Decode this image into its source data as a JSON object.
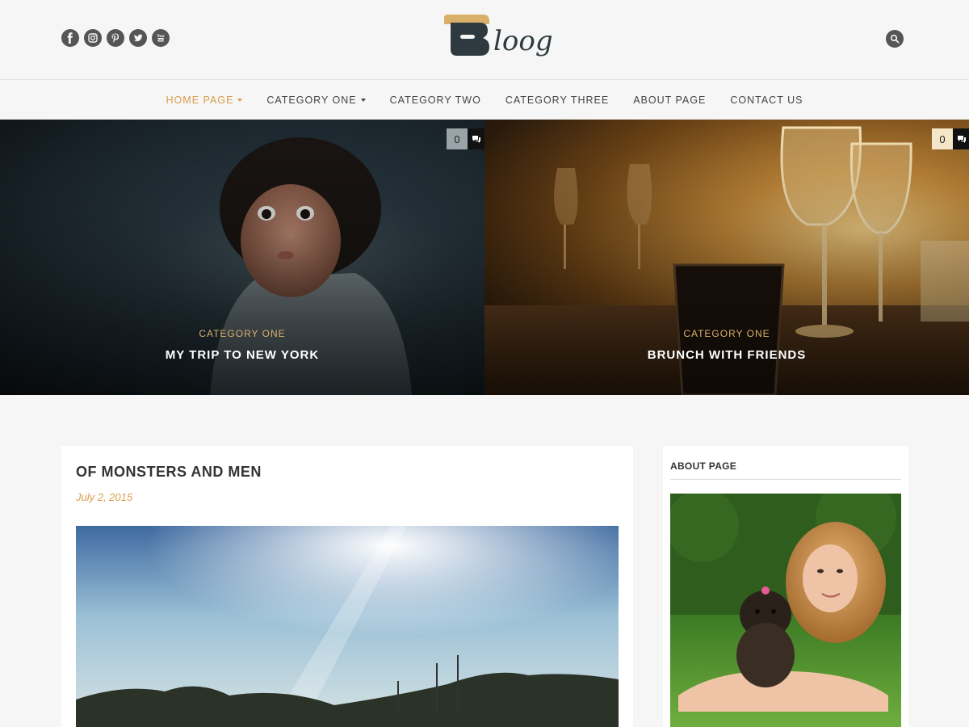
{
  "header": {
    "social": [
      {
        "icon": "facebook-icon"
      },
      {
        "icon": "instagram-icon"
      },
      {
        "icon": "pinterest-icon"
      },
      {
        "icon": "twitter-icon"
      },
      {
        "icon": "youtube-icon"
      }
    ],
    "logo_text": "loog",
    "search_icon": "search-icon"
  },
  "nav": {
    "items": [
      {
        "label": "HOME PAGE",
        "active": true,
        "dropdown": true
      },
      {
        "label": "CATEGORY ONE",
        "active": false,
        "dropdown": true
      },
      {
        "label": "CATEGORY TWO",
        "active": false,
        "dropdown": false
      },
      {
        "label": "CATEGORY THREE",
        "active": false,
        "dropdown": false
      },
      {
        "label": "ABOUT PAGE",
        "active": false,
        "dropdown": false
      },
      {
        "label": "CONTACT US",
        "active": false,
        "dropdown": false
      }
    ]
  },
  "slides": [
    {
      "category": "CATEGORY ONE",
      "title": "MY TRIP TO NEW YORK",
      "comments": "0"
    },
    {
      "category": "CATEGORY ONE",
      "title": "BRUNCH WITH FRIENDS",
      "comments": "0"
    }
  ],
  "post": {
    "title": "OF MONSTERS AND MEN",
    "date": "July 2, 2015"
  },
  "sidebar": {
    "widget_title": "ABOUT PAGE"
  },
  "colors": {
    "accent": "#d99c4a",
    "text": "#333333",
    "background": "#f6f6f6"
  }
}
